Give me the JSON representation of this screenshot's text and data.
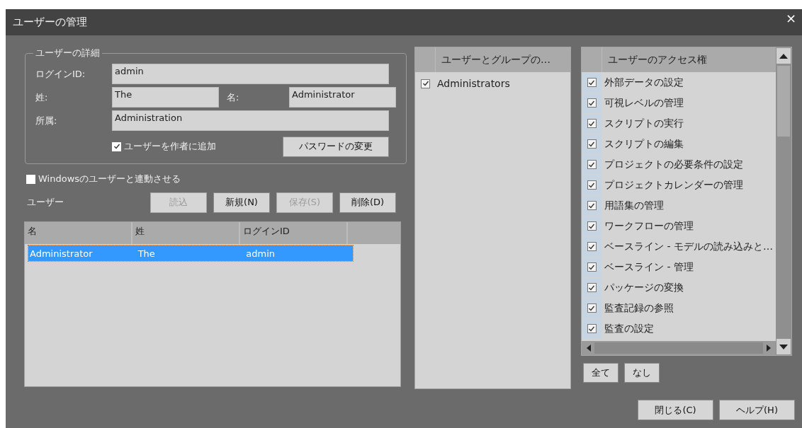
{
  "window": {
    "title": "ユーザーの管理",
    "close": "×"
  },
  "details": {
    "title": "ユーザーの詳細",
    "login_id": {
      "label": "ログインID:",
      "value": "admin"
    },
    "last_name": {
      "label": "姓:",
      "value": "The"
    },
    "first_name": {
      "label": "名:",
      "value": "Administrator"
    },
    "department": {
      "label": "所属:",
      "value": "Administration"
    },
    "add_as_author": {
      "label": "ユーザーを作者に追加",
      "checked": true
    },
    "change_password": "パスワードの変更"
  },
  "windows_sync": {
    "label": "Windowsのユーザーと連動させる",
    "checked": false
  },
  "users": {
    "label": "ユーザー",
    "buttons": [
      {
        "label": "読込",
        "disabled": true
      },
      {
        "label": "新規(N)",
        "disabled": false
      },
      {
        "label": "保存(S)",
        "disabled": true
      },
      {
        "label": "削除(D)",
        "disabled": false
      }
    ],
    "table": {
      "columns": [
        "名",
        "姓",
        "ログインID"
      ],
      "rows": [
        {
          "cells": [
            "Administrator",
            "The",
            "admin"
          ],
          "selected": true
        }
      ]
    }
  },
  "groups": {
    "column": "ユーザーとグループの…",
    "items": [
      {
        "label": "Administrators",
        "checked": true
      }
    ]
  },
  "permissions": {
    "column": "ユーザーのアクセス権",
    "items": [
      {
        "label": "外部データの設定",
        "checked": true
      },
      {
        "label": "可視レベルの管理",
        "checked": true
      },
      {
        "label": "スクリプトの実行",
        "checked": true
      },
      {
        "label": "スクリプトの編集",
        "checked": true
      },
      {
        "label": "プロジェクトの必要条件の設定",
        "checked": true
      },
      {
        "label": "プロジェクトカレンダーの管理",
        "checked": true
      },
      {
        "label": "用語集の管理",
        "checked": true
      },
      {
        "label": "ワークフローの管理",
        "checked": true
      },
      {
        "label": "ベースライン - モデルの読み込みと…",
        "checked": true
      },
      {
        "label": "ベースライン - 管理",
        "checked": true
      },
      {
        "label": "パッケージの変換",
        "checked": true
      },
      {
        "label": "監査記録の参照",
        "checked": true
      },
      {
        "label": "監査の設定",
        "checked": true
      }
    ]
  },
  "selection_buttons": [
    "全て",
    "なし"
  ],
  "footer_buttons": [
    "閉じる(C)",
    "ヘルプ(H)"
  ]
}
